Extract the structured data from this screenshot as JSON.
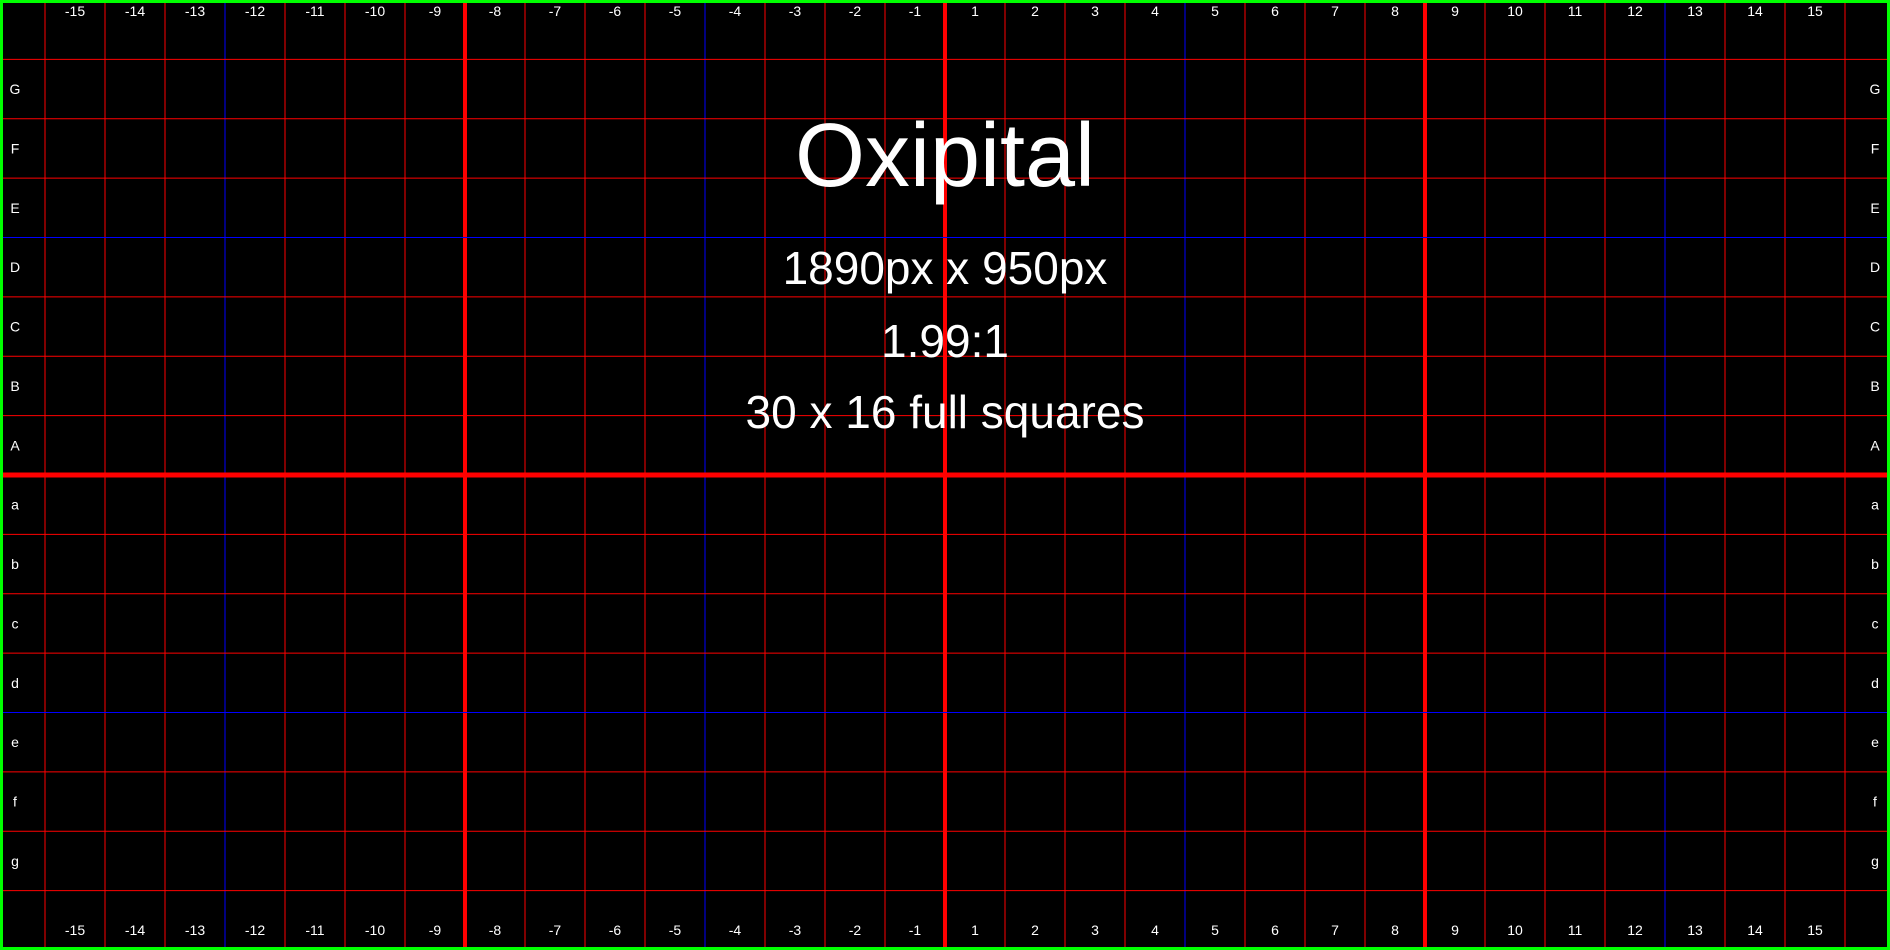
{
  "colors": {
    "background": "#000000",
    "border": "#00ff00",
    "minor_line": "#ff0000",
    "major_line": "#ff0000",
    "quarter_line": "#0000ff",
    "label": "#ffffff"
  },
  "heading": {
    "title": "Oxipital",
    "dimensions": "1890px x 950px",
    "ratio": "1.99:1",
    "squares": "30 x 16 full squares"
  },
  "column_labels": [
    "-15",
    "-14",
    "-13",
    "-12",
    "-11",
    "-10",
    "-9",
    "-8",
    "-7",
    "-6",
    "-5",
    "-4",
    "-3",
    "-2",
    "-1",
    "1",
    "2",
    "3",
    "4",
    "5",
    "6",
    "7",
    "8",
    "9",
    "10",
    "11",
    "12",
    "13",
    "14",
    "15"
  ],
  "upper_row_labels": [
    "G",
    "F",
    "E",
    "D",
    "C",
    "B",
    "A"
  ],
  "lower_row_labels": [
    "a",
    "b",
    "c",
    "d",
    "e",
    "f",
    "g"
  ]
}
